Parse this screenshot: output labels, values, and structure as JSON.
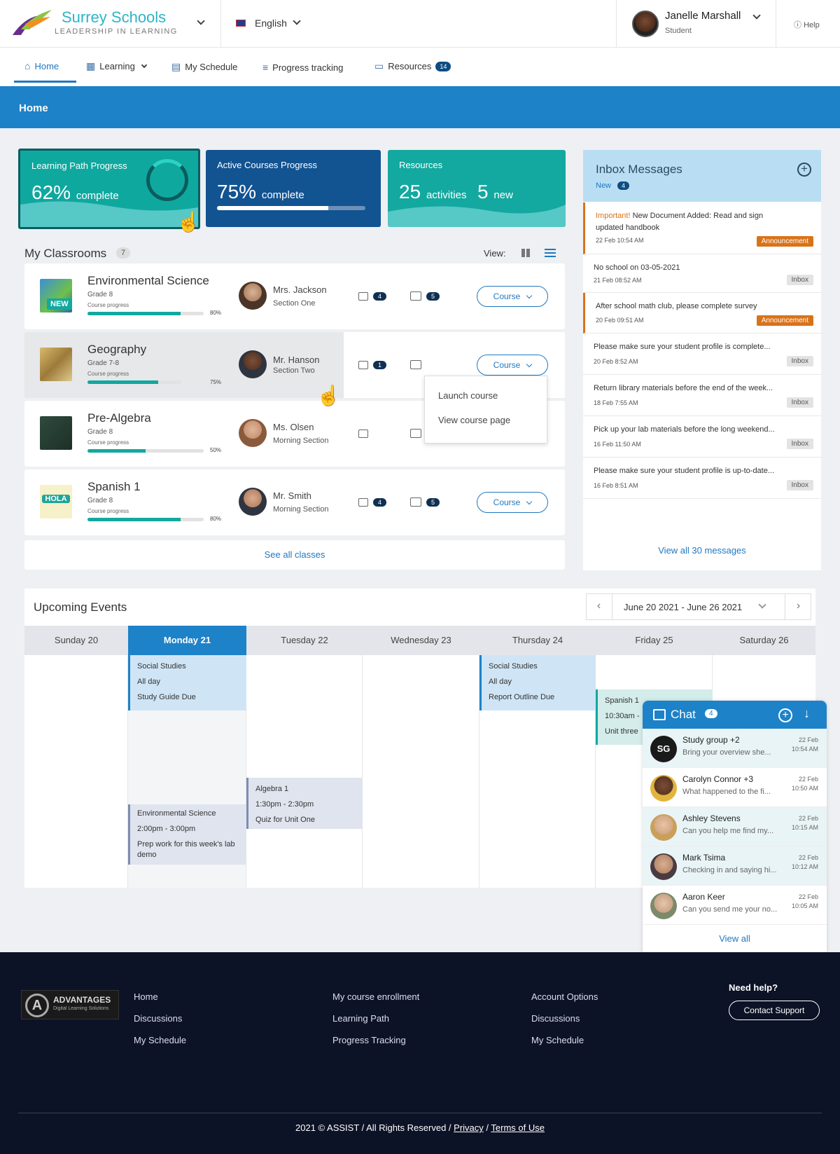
{
  "header": {
    "brand_name": "Surrey Schools",
    "brand_tagline": "LEADERSHIP IN LEARNING",
    "language": "English",
    "user_name": "Janelle Marshall",
    "user_role": "Student",
    "help": "Help"
  },
  "nav": {
    "home": "Home",
    "learning": "Learning",
    "schedule": "My Schedule",
    "progress": "Progress tracking",
    "resources": "Resources",
    "resources_count": "14"
  },
  "banner_title": "Home",
  "stats": {
    "learning_path": {
      "title": "Learning Path Progress",
      "value": "62%",
      "suffix": "complete"
    },
    "active_courses": {
      "title": "Active Courses Progress",
      "value": "75%",
      "suffix": "complete",
      "progress": 0.75
    },
    "resources": {
      "title": "Resources",
      "activities_value": "25",
      "activities_label": "activities",
      "new_value": "5",
      "new_label": "new"
    }
  },
  "classrooms": {
    "title": "My Classrooms",
    "count": "7",
    "view_label": "View:",
    "new_badge": "NEW",
    "progress_label": "Course progress",
    "course_button": "Course",
    "rows": [
      {
        "title": "Environmental Science",
        "grade": "Grade 8",
        "percent": "80%",
        "progress": 0.8,
        "teacher": "Mrs. Jackson",
        "section": "Section One",
        "inbox_count": "4",
        "msg_count": "5"
      },
      {
        "title": "Geography",
        "grade": "Grade 7-8",
        "percent": "75%",
        "progress": 0.75,
        "teacher": "Mr. Hanson",
        "section": "Section Two",
        "inbox_count": "1",
        "msg_count": ""
      },
      {
        "title": "Pre-Algebra",
        "grade": "Grade 8",
        "percent": "50%",
        "progress": 0.5,
        "teacher": "Ms. Olsen",
        "section": "Morning Section",
        "inbox_count": "",
        "msg_count": ""
      },
      {
        "title": "Spanish 1",
        "grade": "Grade 8",
        "percent": "80%",
        "progress": 0.8,
        "teacher": "Mr. Smith",
        "section": "Morning Section",
        "inbox_count": "4",
        "msg_count": "5"
      }
    ],
    "dropdown": {
      "launch": "Launch course",
      "view": "View course page"
    },
    "see_all": "See all classes"
  },
  "inbox": {
    "title": "Inbox Messages",
    "new_label": "New",
    "new_count": "4",
    "messages": [
      {
        "important": "Important!",
        "text": "New Document Added: Read and sign updated handbook",
        "date": "22 Feb  10:54 AM",
        "tag": "Announcement"
      },
      {
        "important": "",
        "text": "No school on 03-05-2021",
        "date": "21 Feb  08:52 AM",
        "tag": "Inbox"
      },
      {
        "important": "",
        "text": "After school math club, please complete survey",
        "date": "20 Feb  09:51 AM",
        "tag": "Announcement"
      },
      {
        "important": "",
        "text": "Please make sure your student profile is complete...",
        "date": "20 Feb  8:52 AM",
        "tag": "Inbox"
      },
      {
        "important": "",
        "text": "Return library materials before the end of the week...",
        "date": "18 Feb  7:55 AM",
        "tag": "Inbox"
      },
      {
        "important": "",
        "text": "Pick up your lab materials before the long weekend...",
        "date": "16 Feb  11:50 AM",
        "tag": "Inbox"
      },
      {
        "important": "",
        "text": "Please make sure your student profile is up-to-date...",
        "date": "16 Feb  8:51 AM",
        "tag": "Inbox"
      }
    ],
    "view_all": "View all 30 messages"
  },
  "events": {
    "title": "Upcoming Events",
    "range": "June 20 2021 - June 26 2021",
    "days": [
      "Sunday 20",
      "Monday 21",
      "Tuesday 22",
      "Wednesday 23",
      "Thursday 24",
      "Friday 25",
      "Saturday 26"
    ],
    "items": {
      "mon_ss": [
        "Social Studies",
        "All day",
        "Study Guide Due"
      ],
      "mon_es": [
        "Environmental Science",
        "2:00pm - 3:00pm",
        "Prep work for this week's lab demo"
      ],
      "tue_alg": [
        "Algebra 1",
        "1:30pm - 2:30pm",
        "Quiz for Unit One"
      ],
      "thu_ss": [
        "Social Studies",
        "All day",
        "Report Outline Due"
      ],
      "fri_sp": [
        "Spanish 1",
        "10:30am -",
        "Unit three"
      ]
    }
  },
  "chat": {
    "title": "Chat",
    "count": "4",
    "items": [
      {
        "name": "Study group +2",
        "msg": "Bring your overview she...",
        "date": "22 Feb",
        "time": "10:54 AM",
        "initials": "SG"
      },
      {
        "name": "Carolyn Connor +3",
        "msg": "What happened to the fi...",
        "date": "22 Feb",
        "time": "10:50 AM",
        "initials": ""
      },
      {
        "name": "Ashley Stevens",
        "msg": "Can you help me find my...",
        "date": "22 Feb",
        "time": "10:15 AM",
        "initials": ""
      },
      {
        "name": "Mark Tsima",
        "msg": "Checking in and saying hi...",
        "date": "22 Feb",
        "time": "10:12 AM",
        "initials": ""
      },
      {
        "name": "Aaron Keer",
        "msg": "Can you send me your no...",
        "date": "22 Feb",
        "time": "10:05 AM",
        "initials": ""
      }
    ],
    "view_all": "View all"
  },
  "footer": {
    "logo_title": "ADVANTAGES",
    "logo_sub": "Digital Learning Solutions",
    "logo_letter": "A",
    "col1": [
      "Home",
      "Discussions",
      "My Schedule"
    ],
    "col2": [
      "My course enrollment",
      "Learning Path",
      "Progress Tracking"
    ],
    "col3": [
      "Account Options",
      "Discussions",
      "My Schedule"
    ],
    "need_help": "Need help?",
    "contact": "Contact Support",
    "copyright": "2021 © ASSIST / All Rights Reserved /",
    "privacy": "Privacy",
    "terms": "Terms of Use"
  }
}
